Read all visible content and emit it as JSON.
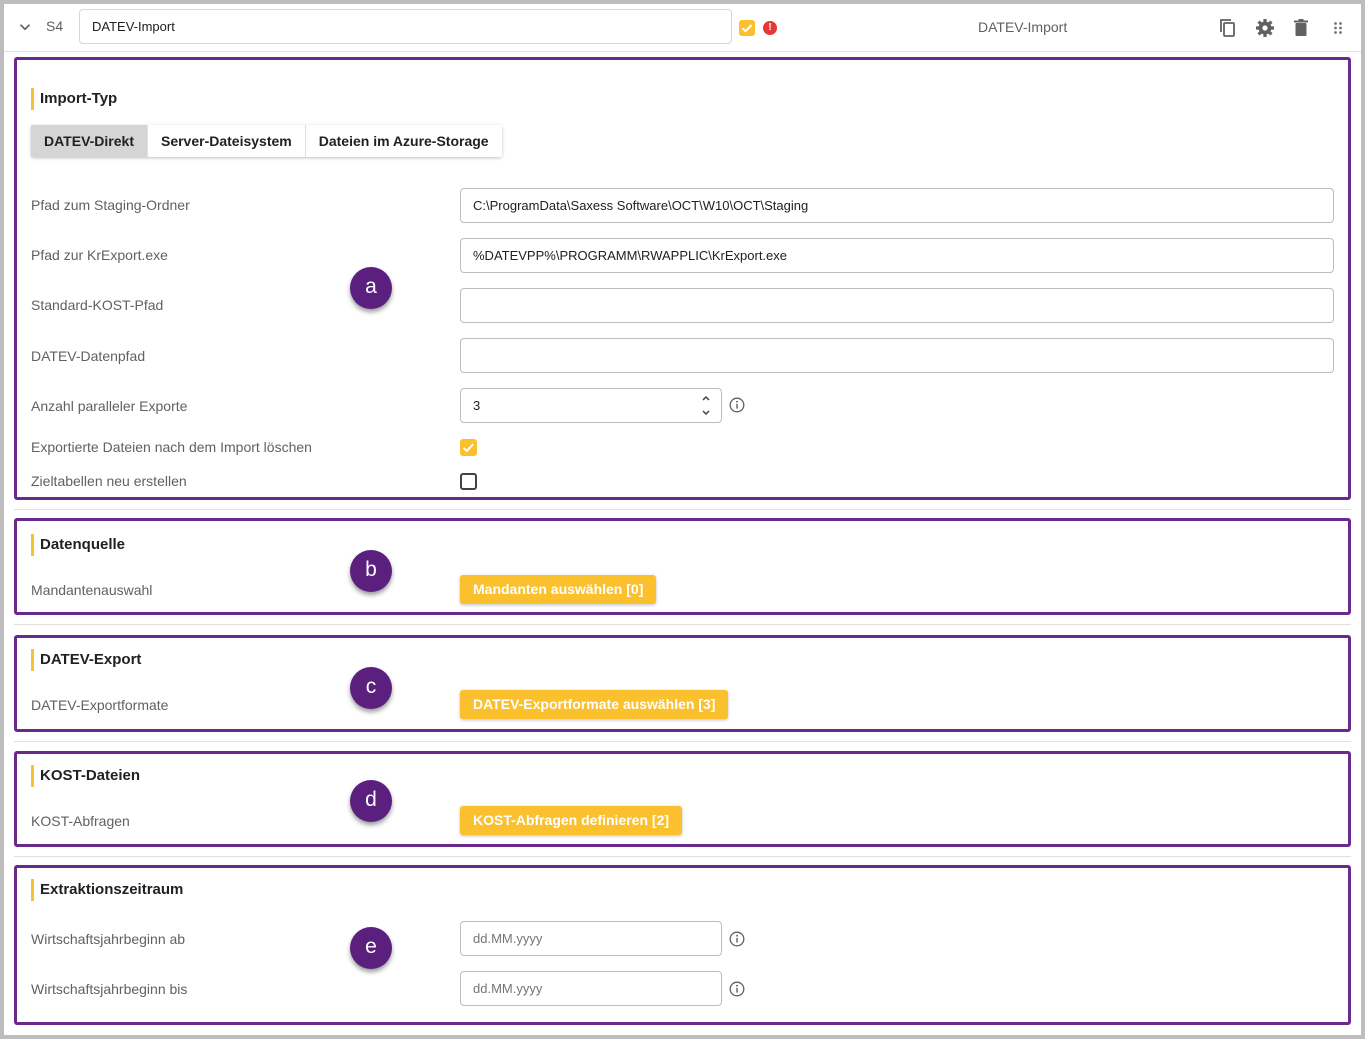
{
  "header": {
    "step": "S4",
    "title_value": "DATEV-Import",
    "center_title": "DATEV-Import"
  },
  "colors": {
    "accent": "#fbc02d",
    "annotation": "#6a2a8c",
    "error": "#e53935"
  },
  "icons": [
    "chevron-down-icon",
    "checkbox-checked-icon",
    "error-icon",
    "copy-icon",
    "gear-icon",
    "trash-icon",
    "drag-handle-icon",
    "info-icon"
  ],
  "import_typ": {
    "title": "Import-Typ",
    "tabs": [
      "DATEV-Direkt",
      "Server-Dateisystem",
      "Dateien im Azure-Storage"
    ],
    "fields": {
      "staging_label": "Pfad zum Staging-Ordner",
      "staging_value": "C:\\ProgramData\\Saxess Software\\OCT\\W10\\OCT\\Staging",
      "krexport_label": "Pfad zur KrExport.exe",
      "krexport_value": "%DATEVPP%\\PROGRAMM\\RWAPPLIC\\KrExport.exe",
      "kost_label": "Standard-KOST-Pfad",
      "kost_value": "",
      "datenpfad_label": "DATEV-Datenpfad",
      "datenpfad_value": "",
      "parallel_label": "Anzahl paralleler Exporte",
      "parallel_value": "3",
      "delete_label": "Exportierte Dateien nach dem Import löschen",
      "delete_checked": true,
      "recreate_label": "Zieltabellen neu erstellen",
      "recreate_checked": false
    },
    "badge": "a"
  },
  "datenquelle": {
    "title": "Datenquelle",
    "label": "Mandantenauswahl",
    "button": "Mandanten auswählen [0]",
    "badge": "b"
  },
  "datev_export": {
    "title": "DATEV-Export",
    "label": "DATEV-Exportformate",
    "button": "DATEV-Exportformate auswählen [3]",
    "badge": "c"
  },
  "kost": {
    "title": "KOST-Dateien",
    "label": "KOST-Abfragen",
    "button": "KOST-Abfragen definieren [2]",
    "badge": "d"
  },
  "extraktion": {
    "title": "Extraktionszeitraum",
    "from_label": "Wirtschaftsjahrbeginn ab",
    "from_placeholder": "dd.MM.yyyy",
    "to_label": "Wirtschaftsjahrbeginn bis",
    "to_placeholder": "dd.MM.yyyy",
    "badge": "e"
  }
}
